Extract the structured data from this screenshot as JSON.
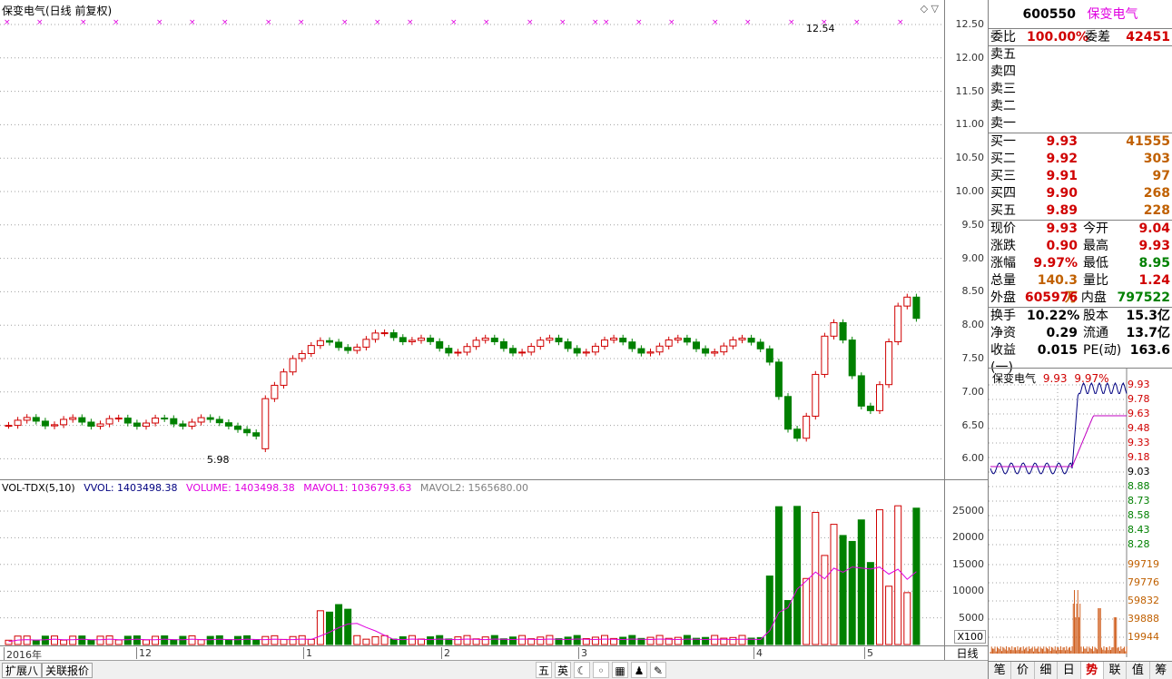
{
  "main": {
    "title": "保变电气(日线 前复权)",
    "controls": "◇ ▽",
    "annot_low": "5.98",
    "annot_high": "12.54"
  },
  "price_axis": [
    "12.50",
    "12.00",
    "11.50",
    "11.00",
    "10.50",
    "10.00",
    "9.50",
    "9.00",
    "8.50",
    "8.00",
    "7.50",
    "7.00",
    "6.50",
    "6.00"
  ],
  "volume": {
    "indicator": "VOL-TDX(5,10)",
    "vvol": "VVOL: 1403498.38",
    "volume": "VOLUME: 1403498.38",
    "mavol1": "MAVOL1: 1036793.63",
    "mavol2": "MAVOL2: 1565680.00",
    "axis": [
      "25000",
      "20000",
      "15000",
      "10000",
      "5000"
    ],
    "unit": "X100"
  },
  "dates": {
    "labels": [
      "2016年",
      "12",
      "1",
      "2",
      "3",
      "4",
      "5"
    ],
    "period": "日线"
  },
  "bottom_bar": {
    "btn1": "扩展八",
    "btn2": "关联报价",
    "icons": [
      "五",
      "英",
      "☾",
      "◦",
      "▦",
      "♟",
      "✎"
    ]
  },
  "quote": {
    "code": "600550",
    "name": "保变电气",
    "wei_bi_label": "委比",
    "wei_bi": "100.00%",
    "wei_cha_label": "委差",
    "wei_cha": "42451",
    "sell": [
      {
        "label": "卖五",
        "price": "",
        "vol": ""
      },
      {
        "label": "卖四",
        "price": "",
        "vol": ""
      },
      {
        "label": "卖三",
        "price": "",
        "vol": ""
      },
      {
        "label": "卖二",
        "price": "",
        "vol": ""
      },
      {
        "label": "卖一",
        "price": "",
        "vol": ""
      }
    ],
    "buy": [
      {
        "label": "买一",
        "price": "9.93",
        "vol": "41555"
      },
      {
        "label": "买二",
        "price": "9.92",
        "vol": "303"
      },
      {
        "label": "买三",
        "price": "9.91",
        "vol": "97"
      },
      {
        "label": "买四",
        "price": "9.90",
        "vol": "268"
      },
      {
        "label": "买五",
        "price": "9.89",
        "vol": "228"
      }
    ],
    "stats": [
      {
        "l1": "现价",
        "v1": "9.93",
        "c1": "red",
        "l2": "今开",
        "v2": "9.04",
        "c2": "red"
      },
      {
        "l1": "涨跌",
        "v1": "0.90",
        "c1": "red",
        "l2": "最高",
        "v2": "9.93",
        "c2": "red"
      },
      {
        "l1": "涨幅",
        "v1": "9.97%",
        "c1": "red",
        "l2": "最低",
        "v2": "8.95",
        "c2": "green"
      },
      {
        "l1": "总量",
        "v1": "140.3万",
        "c1": "orange",
        "l2": "量比",
        "v2": "1.24",
        "c2": "red"
      },
      {
        "l1": "外盘",
        "v1": "605976",
        "c1": "red",
        "l2": "内盘",
        "v2": "797522",
        "c2": "green"
      }
    ],
    "stats2": [
      {
        "l1": "换手",
        "v1": "10.22%",
        "l2": "股本",
        "v2": "15.3亿"
      },
      {
        "l1": "净资",
        "v1": "0.29",
        "l2": "流通",
        "v2": "13.7亿"
      },
      {
        "l1": "收益(一)",
        "v1": "0.015",
        "l2": "PE(动)",
        "v2": "163.6"
      }
    ]
  },
  "mini": {
    "name": "保变电气",
    "price": "9.93",
    "pct": "9.97%",
    "price_axis": [
      "9.93",
      "9.78",
      "9.63",
      "9.48",
      "9.33",
      "9.18",
      "9.03",
      "8.88",
      "8.73",
      "8.58",
      "8.43",
      "8.28"
    ],
    "vol_axis": [
      "99719",
      "79776",
      "59832",
      "39888",
      "19944"
    ]
  },
  "tabs": [
    "笔",
    "价",
    "细",
    "日",
    "势",
    "联",
    "值",
    "筹"
  ],
  "active_tab": "势",
  "colors": {
    "up": "#d00000",
    "down": "#008000",
    "ma": "#e000e0"
  }
}
